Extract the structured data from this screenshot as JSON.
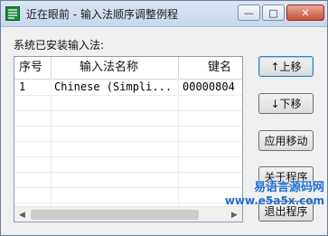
{
  "window": {
    "title": "近在眼前 - 输入法顺序调整例程",
    "controls": {
      "minimize": "—",
      "maximize": "□",
      "close": "✕"
    }
  },
  "group_label": "系统已安装输入法:",
  "list": {
    "columns": [
      "序号",
      "输入法名称",
      "键名"
    ],
    "rows": [
      {
        "index": "1",
        "name": "Chinese (Simpli...",
        "key": "00000804"
      }
    ]
  },
  "buttons": {
    "move_up": "↑上移",
    "move_down": "↓下移",
    "apply": "应用移动",
    "about": "关于程序",
    "exit": "退出程序"
  },
  "watermark": {
    "text": "易语言源码网",
    "url": "www.e5a5x.com"
  },
  "icons": {
    "app": "app-icon",
    "scroll_left": "scroll-left-icon",
    "scroll_right": "scroll-right-icon"
  }
}
